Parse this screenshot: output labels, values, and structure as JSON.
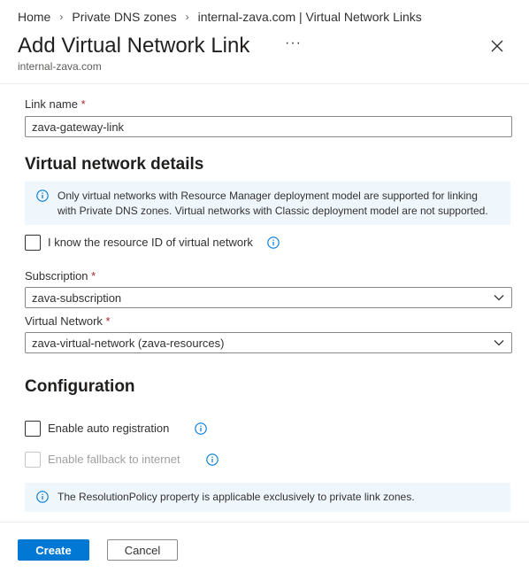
{
  "breadcrumb": [
    {
      "label": "Home"
    },
    {
      "label": "Private DNS zones"
    },
    {
      "label": "internal-zava.com | Virtual Network Links"
    }
  ],
  "header": {
    "title": "Add Virtual Network Link",
    "subtitle": "internal-zava.com",
    "more_label": "···",
    "close_icon": "close-icon"
  },
  "link_name": {
    "label": "Link name",
    "required_mark": "*",
    "value": "zava-gateway-link"
  },
  "vnet_details": {
    "heading": "Virtual network details",
    "info_line1": "Only virtual networks with Resource Manager deployment model are supported for linking",
    "info_line2": "with Private DNS zones. Virtual networks with Classic deployment model are not supported.",
    "resource_id_checkbox": {
      "label": "I know the resource ID of virtual network",
      "checked": false
    },
    "subscription": {
      "label": "Subscription",
      "required_mark": "*",
      "value": "zava-subscription"
    },
    "virtual_network": {
      "label": "Virtual Network",
      "required_mark": "*",
      "value": "zava-virtual-network (zava-resources)"
    }
  },
  "configuration": {
    "heading": "Configuration",
    "auto_registration": {
      "label": "Enable auto registration",
      "checked": false
    },
    "fallback": {
      "label": "Enable fallback to internet",
      "checked": false,
      "disabled": true
    },
    "info_text": "The ResolutionPolicy property is applicable exclusively to private link zones."
  },
  "footer": {
    "create_label": "Create",
    "cancel_label": "Cancel"
  },
  "colors": {
    "accent": "#0078d4",
    "info_background": "#eff6fc",
    "required": "#a4262c"
  }
}
